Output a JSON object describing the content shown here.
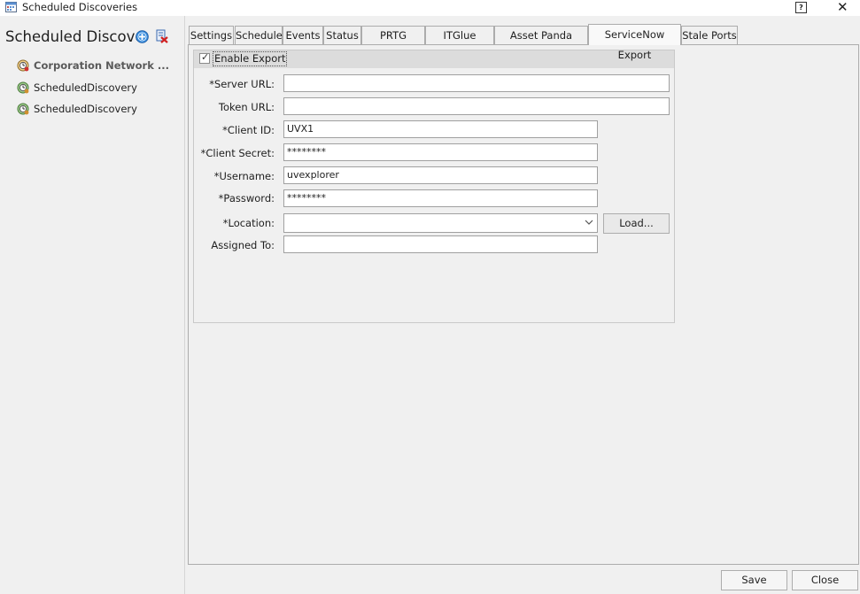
{
  "window": {
    "title": "Scheduled Discoveries",
    "help_label": "?",
    "close_glyph": "✕"
  },
  "left_panel": {
    "title": "Scheduled Discoveries",
    "items": [
      {
        "label": "Corporation Network ...",
        "icon": "discovery-icon",
        "bold": true
      },
      {
        "label": "ScheduledDiscovery",
        "icon": "discovery-icon",
        "bold": false
      },
      {
        "label": "ScheduledDiscovery",
        "icon": "discovery-icon",
        "bold": false
      }
    ]
  },
  "tabs": [
    {
      "label": "Settings"
    },
    {
      "label": "Schedule"
    },
    {
      "label": "Events"
    },
    {
      "label": "Status"
    },
    {
      "label": "PRTG Export"
    },
    {
      "label": "ITGlue Export"
    },
    {
      "label": "Asset Panda Export"
    },
    {
      "label": "ServiceNow Export",
      "active": true
    },
    {
      "label": "Stale Ports"
    }
  ],
  "form": {
    "enable_label": "Enable Export",
    "enable_checked": true,
    "fields": {
      "server_url": {
        "label": "*Server URL:",
        "value": ""
      },
      "token_url": {
        "label": "Token URL:",
        "value": ""
      },
      "client_id": {
        "label": "*Client ID:",
        "value": "UVX1"
      },
      "client_secret": {
        "label": "*Client Secret:",
        "value": "********"
      },
      "username": {
        "label": "*Username:",
        "value": "uvexplorer"
      },
      "password": {
        "label": "*Password:",
        "value": "********"
      },
      "location": {
        "label": "*Location:",
        "value": ""
      },
      "assigned_to": {
        "label": "Assigned To:",
        "value": ""
      }
    },
    "load_label": "Load..."
  },
  "footer": {
    "save_label": "Save",
    "close_label": "Close"
  }
}
